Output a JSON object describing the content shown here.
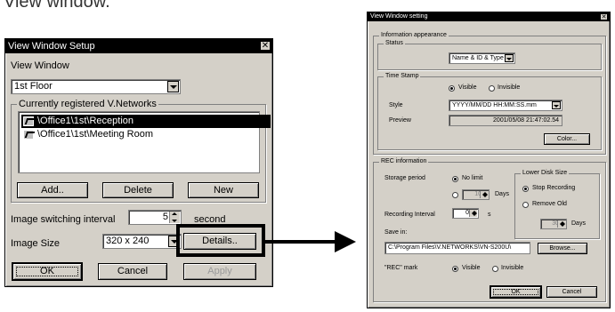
{
  "caption": "View window.",
  "setup_dialog": {
    "title": "View Window Setup",
    "view_window_label": "View Window",
    "view_window_value": "1st Floor",
    "registered_group": "Currently registered V.Networks",
    "networks": [
      "\\Office1\\1st\\Reception",
      "\\Office1\\1st\\Meeting Room"
    ],
    "add_label": "Add..",
    "delete_label": "Delete",
    "new_label": "New",
    "interval_label": "Image switching interval",
    "interval_value": "5",
    "interval_unit": "second",
    "size_label": "Image Size",
    "size_value": "320 x 240",
    "details_label": "Details..",
    "ok_label": "OK",
    "cancel_label": "Cancel",
    "apply_label": "Apply"
  },
  "setting_dialog": {
    "title": "View Window setting",
    "info_group": "Information appearance",
    "status_group": "Status",
    "status_value": "Name & ID & Type",
    "timestamp_group": "Time Stamp",
    "visible_label": "Visible",
    "invisible_label": "Invisible",
    "style_label": "Style",
    "style_value": "YYYY/MM/DD HH:MM:SS.mm",
    "preview_label": "Preview",
    "preview_value": "2001/05/08 21:47:02.54",
    "color_label": "Color...",
    "rec_group": "REC information",
    "storage_label": "Storage period",
    "no_limit_label": "No limit",
    "days_value": "10",
    "days_label": "Days",
    "lower_disk_group": "Lower Disk Size",
    "stop_recording_label": "Stop Recording",
    "remove_old_label": "Remove Old",
    "remove_days_value": "30",
    "remove_days_label": "Days",
    "rec_interval_label": "Recording Interval",
    "rec_interval_value": "0",
    "rec_interval_unit": "s",
    "save_in_label": "Save in:",
    "save_in_value": "C:\\Program Files\\V.NETWORKS\\VN-S200U\\",
    "browse_label": "Browse...",
    "rec_mark_label": "\"REC\" mark",
    "mark_visible_label": "Visible",
    "mark_invisible_label": "Invisible",
    "ok_label": "OK",
    "cancel_label": "Cancel"
  }
}
